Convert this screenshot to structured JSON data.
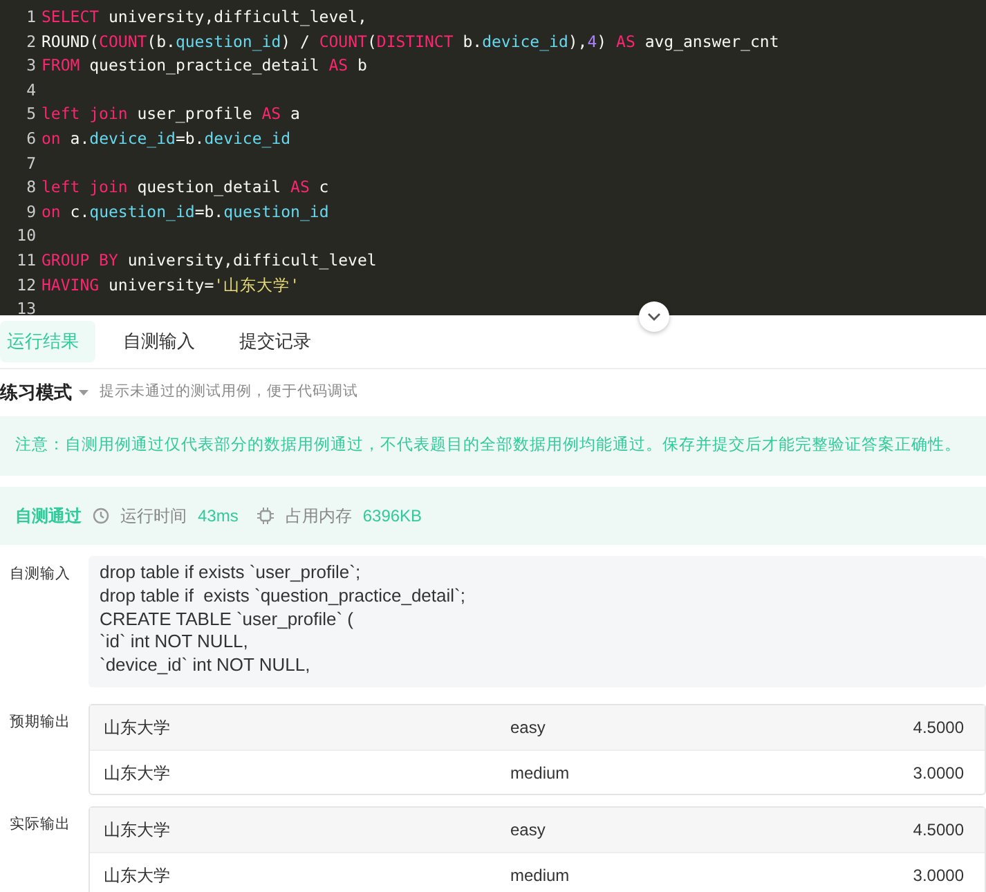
{
  "editor": {
    "lines": [
      {
        "number": "1",
        "tokens": [
          {
            "kind": "kw",
            "text": "SELECT"
          },
          {
            "kind": "plain",
            "text": " university,difficult_level,"
          }
        ]
      },
      {
        "number": "2",
        "tokens": [
          {
            "kind": "plain",
            "text": "ROUND("
          },
          {
            "kind": "kw",
            "text": "COUNT"
          },
          {
            "kind": "plain",
            "text": "(b."
          },
          {
            "kind": "field",
            "text": "question_id"
          },
          {
            "kind": "plain",
            "text": ") / "
          },
          {
            "kind": "kw",
            "text": "COUNT"
          },
          {
            "kind": "plain",
            "text": "("
          },
          {
            "kind": "kw",
            "text": "DISTINCT"
          },
          {
            "kind": "plain",
            "text": " b."
          },
          {
            "kind": "field",
            "text": "device_id"
          },
          {
            "kind": "plain",
            "text": "),"
          },
          {
            "kind": "num",
            "text": "4"
          },
          {
            "kind": "plain",
            "text": ") "
          },
          {
            "kind": "kw",
            "text": "AS"
          },
          {
            "kind": "plain",
            "text": " avg_answer_cnt"
          }
        ]
      },
      {
        "number": "3",
        "tokens": [
          {
            "kind": "kw",
            "text": "FROM"
          },
          {
            "kind": "plain",
            "text": " question_practice_detail "
          },
          {
            "kind": "kw",
            "text": "AS"
          },
          {
            "kind": "plain",
            "text": " b"
          }
        ]
      },
      {
        "number": "4"
      },
      {
        "number": "5",
        "tokens": [
          {
            "kind": "kw",
            "text": "left join"
          },
          {
            "kind": "plain",
            "text": " user_profile "
          },
          {
            "kind": "kw",
            "text": "AS"
          },
          {
            "kind": "plain",
            "text": " a"
          }
        ]
      },
      {
        "number": "6",
        "tokens": [
          {
            "kind": "kw",
            "text": "on"
          },
          {
            "kind": "plain",
            "text": " a."
          },
          {
            "kind": "field",
            "text": "device_id"
          },
          {
            "kind": "plain",
            "text": "=b."
          },
          {
            "kind": "field",
            "text": "device_id"
          }
        ]
      },
      {
        "number": "7"
      },
      {
        "number": "8",
        "tokens": [
          {
            "kind": "kw",
            "text": "left join"
          },
          {
            "kind": "plain",
            "text": " question_detail "
          },
          {
            "kind": "kw",
            "text": "AS"
          },
          {
            "kind": "plain",
            "text": " c"
          }
        ]
      },
      {
        "number": "9",
        "tokens": [
          {
            "kind": "kw",
            "text": "on"
          },
          {
            "kind": "plain",
            "text": " c."
          },
          {
            "kind": "field",
            "text": "question_id"
          },
          {
            "kind": "plain",
            "text": "=b."
          },
          {
            "kind": "field",
            "text": "question_id"
          }
        ]
      },
      {
        "number": "10"
      },
      {
        "number": "11",
        "tokens": [
          {
            "kind": "kw",
            "text": "GROUP BY"
          },
          {
            "kind": "plain",
            "text": " university,difficult_level"
          }
        ]
      },
      {
        "number": "12",
        "tokens": [
          {
            "kind": "kw",
            "text": "HAVING"
          },
          {
            "kind": "plain",
            "text": " university="
          },
          {
            "kind": "str",
            "text": "'山东大学'"
          }
        ]
      },
      {
        "number": "13"
      }
    ]
  },
  "tabs": [
    {
      "label": "运行结果",
      "selected": true
    },
    {
      "label": "自测输入",
      "selected": false
    },
    {
      "label": "提交记录",
      "selected": false
    }
  ],
  "mode": {
    "label": "练习模式",
    "hint": "提示未通过的测试用例，便于代码调试"
  },
  "notice": "注意：自测用例通过仅代表部分的数据用例通过，不代表题目的全部数据用例均能通过。保存并提交后才能完整验证答案正确性。",
  "status": {
    "result": "自测通过",
    "time_label": "运行时间",
    "time": "43ms",
    "memory_label": "占用内存",
    "memory": "6396KB"
  },
  "input": {
    "label": "自测输入",
    "lines": [
      "drop table if exists `user_profile`;",
      "drop table if  exists `question_practice_detail`;",
      "CREATE TABLE `user_profile` (",
      "`id` int NOT NULL,",
      "`device_id` int NOT NULL,"
    ]
  },
  "outputs": [
    {
      "label": "预期输出",
      "rows": [
        [
          "山东大学",
          "easy",
          "4.5000"
        ],
        [
          "山东大学",
          "medium",
          "3.0000"
        ]
      ]
    },
    {
      "label": "实际输出",
      "rows": [
        [
          "山东大学",
          "easy",
          "4.5000"
        ],
        [
          "山东大学",
          "medium",
          "3.0000"
        ]
      ]
    }
  ]
}
